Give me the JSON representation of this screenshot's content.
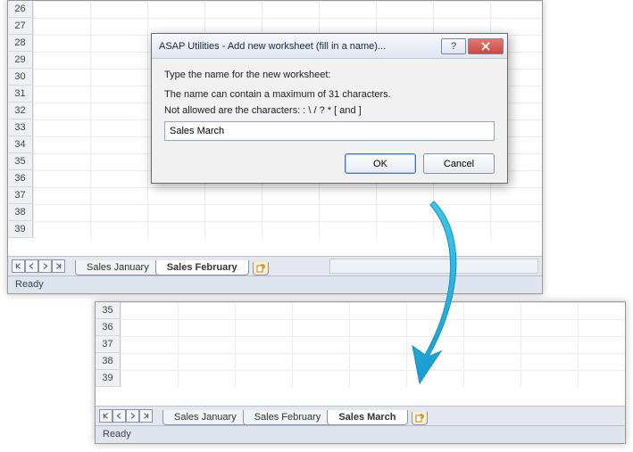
{
  "dialog": {
    "title": "ASAP Utilities - Add new worksheet (fill in a name)...",
    "prompt": "Type the name for the new worksheet:",
    "rule1": "The name can contain a maximum of 31 characters.",
    "rule2": "Not allowed are the characters:   : \\ / ? * [ and ]",
    "input_value": "Sales March",
    "ok": "OK",
    "cancel": "Cancel",
    "help": "?",
    "close": "X"
  },
  "before": {
    "rows": [
      "26",
      "27",
      "28",
      "29",
      "30",
      "31",
      "32",
      "33",
      "34",
      "35",
      "36",
      "37",
      "38",
      "39"
    ],
    "tabs": [
      "Sales January",
      "Sales February"
    ],
    "active_tab": 1,
    "status": "Ready"
  },
  "after": {
    "rows": [
      "35",
      "36",
      "37",
      "38",
      "39"
    ],
    "tabs": [
      "Sales January",
      "Sales February",
      "Sales March"
    ],
    "active_tab": 2,
    "status": "Ready"
  }
}
